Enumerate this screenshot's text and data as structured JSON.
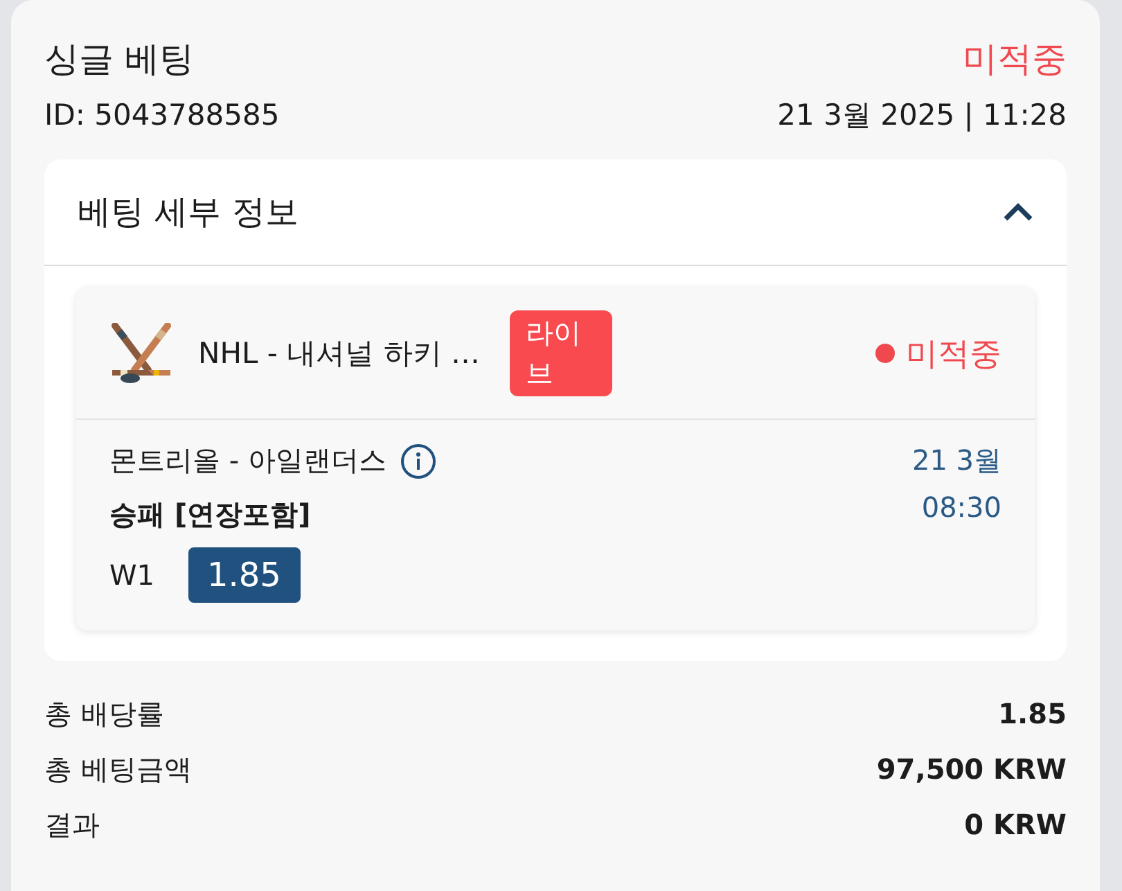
{
  "bet": {
    "type": "싱글 베팅",
    "status": "미적중",
    "id": "ID: 5043788585",
    "datetime": "21 3월 2025 | 11:28"
  },
  "details": {
    "title": "베팅 세부 정보",
    "expanded": true,
    "event": {
      "league": "NHL - 내셔널 하키 …",
      "badge": "라이브",
      "status": "미적중",
      "match": "몬트리올 - 아일랜더스",
      "market": "승패 [연장포함]",
      "date": "21 3월",
      "time": "08:30",
      "selection": "W1",
      "odds": "1.85"
    }
  },
  "summary": [
    {
      "label": "총 배당률",
      "value": "1.85"
    },
    {
      "label": "총 베팅금액",
      "value": "97,500 KRW"
    },
    {
      "label": "결과",
      "value": "0 KRW"
    }
  ]
}
